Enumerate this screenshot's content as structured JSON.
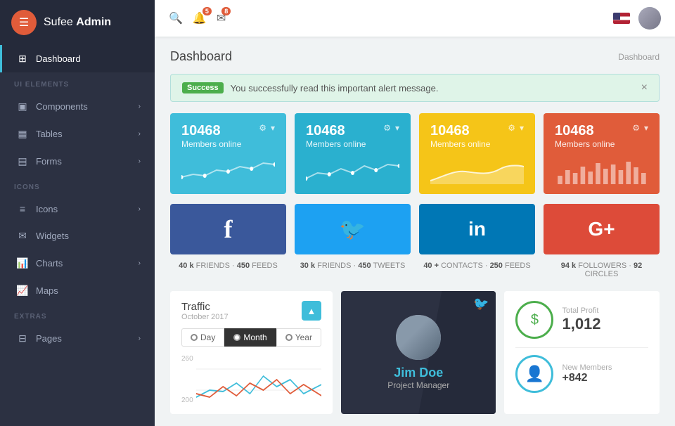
{
  "sidebar": {
    "logo": "Sufee Admin",
    "logo_strong": "Admin",
    "logo_prefix": "Sufee ",
    "nav": [
      {
        "id": "dashboard",
        "label": "Dashboard",
        "icon": "⊞",
        "active": true
      },
      {
        "id": "ui-elements-label",
        "label": "UI ELEMENTS",
        "type": "section"
      },
      {
        "id": "components",
        "label": "Components",
        "icon": "▣",
        "arrow": true
      },
      {
        "id": "tables",
        "label": "Tables",
        "icon": "▦",
        "arrow": true
      },
      {
        "id": "forms",
        "label": "Forms",
        "icon": "▤",
        "arrow": true
      },
      {
        "id": "icons-label",
        "label": "ICONS",
        "type": "section"
      },
      {
        "id": "icons",
        "label": "Icons",
        "icon": "≡",
        "arrow": true
      },
      {
        "id": "widgets",
        "label": "Widgets",
        "icon": "✉",
        "arrow": false
      },
      {
        "id": "charts",
        "label": "Charts",
        "icon": "📊",
        "arrow": true
      },
      {
        "id": "maps",
        "label": "Maps",
        "icon": "📈",
        "arrow": false
      },
      {
        "id": "extras-label",
        "label": "EXTRAS",
        "type": "section"
      },
      {
        "id": "pages",
        "label": "Pages",
        "icon": "⊟",
        "arrow": true
      }
    ]
  },
  "topbar": {
    "search_placeholder": "Search...",
    "notifications_count": "5",
    "messages_count": "8"
  },
  "page": {
    "title": "Dashboard",
    "breadcrumb": "Dashboard"
  },
  "alert": {
    "badge": "Success",
    "message": "You successfully read this important alert message."
  },
  "stat_cards": [
    {
      "num": "10468",
      "label": "Members online",
      "color": "teal",
      "chart_type": "line"
    },
    {
      "num": "10468",
      "label": "Members online",
      "color": "blue",
      "chart_type": "line"
    },
    {
      "num": "10468",
      "label": "Members online",
      "color": "yellow",
      "chart_type": "wave"
    },
    {
      "num": "10468",
      "label": "Members online",
      "color": "red",
      "chart_type": "bar"
    }
  ],
  "social_cards": [
    {
      "id": "facebook",
      "icon": "f",
      "stats": "40 k FRIENDS · 450 FEEDS"
    },
    {
      "id": "twitter",
      "icon": "𝕥",
      "stats": "30 k FRIENDS · 450 TWEETS"
    },
    {
      "id": "linkedin",
      "icon": "in",
      "stats": "40 + CONTACTS · 250 FEEDS"
    },
    {
      "id": "googleplus",
      "icon": "G+",
      "stats": "94 k FOLLOWERS · 92 CIRCLES"
    }
  ],
  "social_stats": [
    {
      "num1": "40 k",
      "label1": "FRIENDS",
      "num2": "450",
      "label2": "FEEDS"
    },
    {
      "num1": "30 k",
      "label1": "FRIENDS",
      "num2": "450",
      "label2": "TWEETS"
    },
    {
      "num1": "40 +",
      "label1": "CONTACTS",
      "num2": "250",
      "label2": "FEEDS"
    },
    {
      "num1": "94 k",
      "label1": "FOLLOWERS",
      "num2": "92",
      "label2": "CIRCLES"
    }
  ],
  "traffic": {
    "title": "Traffic",
    "subtitle": "October 2017",
    "tabs": [
      "Day",
      "Month",
      "Year"
    ],
    "active_tab": "Month",
    "y_labels": [
      "260",
      "200"
    ],
    "upload_tooltip": "Upload"
  },
  "person": {
    "name": "Jim Doe",
    "role": "Project Manager"
  },
  "profit": {
    "label": "Total Profit",
    "value": "1,012",
    "icon": "$"
  }
}
